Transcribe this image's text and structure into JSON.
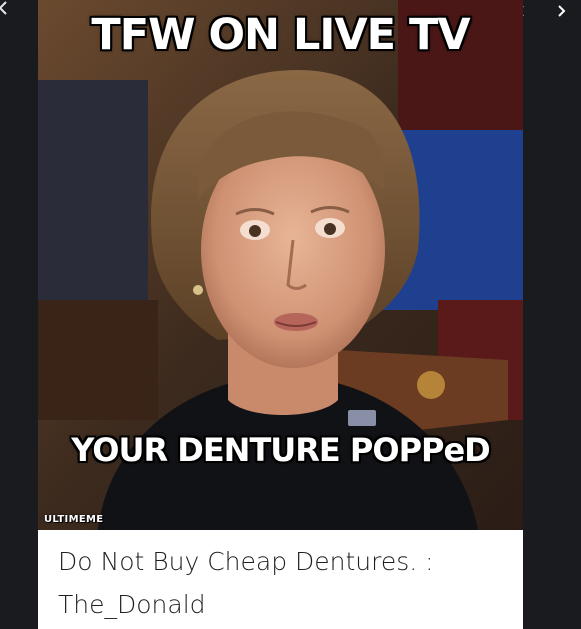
{
  "viewer": {
    "nav_left_icon": "chevron-left-icon",
    "prev_icon": "chevron-left-icon",
    "next_icon": "chevron-right-icon"
  },
  "meme": {
    "top_text": "TFW ON LIVE TV",
    "bottom_text": "YOUR DENTURE POPPeD",
    "watermark": "ULTIMEME"
  },
  "caption": {
    "title": "Do Not Buy Cheap Dentures. : The_Donald"
  },
  "colors": {
    "background": "#1a1b1e",
    "caption_bg": "#ffffff",
    "caption_text": "#1f1f1f",
    "meme_text": "#ffffff"
  }
}
